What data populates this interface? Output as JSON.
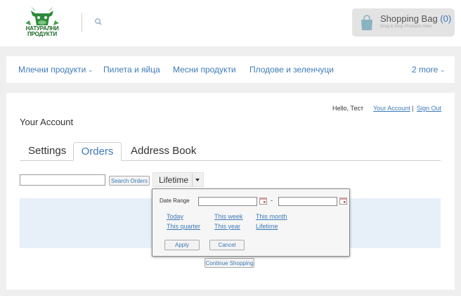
{
  "header": {
    "logo_text_line1": "НАТУРАЛНИ",
    "logo_text_line2": "ПРОДУКТИ",
    "bag_title": "Shopping Bag",
    "bag_count": "(0)",
    "bag_subtitle": "Drag & Drop Products Here"
  },
  "nav": {
    "items": [
      {
        "label": "Млечни продукти",
        "has_chevron": true
      },
      {
        "label": "Пилета и яйца"
      },
      {
        "label": "Месни продукти"
      },
      {
        "label": "Плодове и зеленчуци"
      },
      {
        "label": "2 more",
        "has_chevron": true
      }
    ]
  },
  "account": {
    "hello": "Hello, Тест",
    "your_account_link": "Your Account",
    "separator": "|",
    "sign_out_link": "Sign Out",
    "page_title": "Your Account",
    "tabs": [
      {
        "label": "Settings"
      },
      {
        "label": "Orders",
        "active": true
      },
      {
        "label": "Address Book"
      }
    ],
    "search_value": "",
    "search_button": "Search Orders",
    "period_select": "Lifetime",
    "continue_button": "Continue Shopping"
  },
  "date_popup": {
    "label": "Date Range",
    "from_value": "",
    "to_value": "",
    "dash": "-",
    "ranges": [
      "Today",
      "This week",
      "This month",
      "This quarter",
      "This year",
      "Lifetime"
    ],
    "apply": "Apply",
    "cancel": "Cancel"
  },
  "colors": {
    "link": "#3d7ab8",
    "panel": "#e7f0f9",
    "logo_green": "#2e8b3a"
  }
}
